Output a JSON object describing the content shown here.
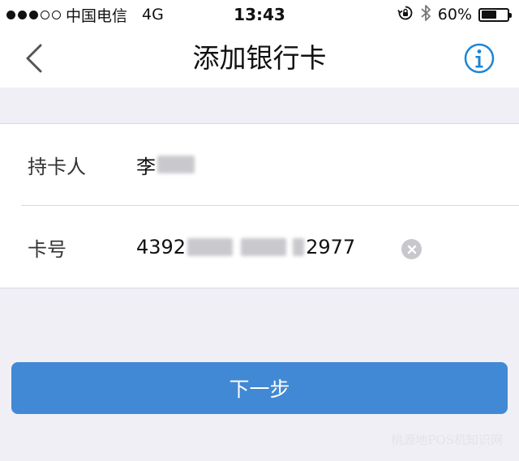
{
  "status_bar": {
    "carrier": "中国电信",
    "network": "4G",
    "time": "13:43",
    "battery_percent": "60%",
    "battery_level": 0.6
  },
  "nav": {
    "title": "添加银行卡",
    "back_icon": "chevron-left-icon",
    "info_icon": "info-icon",
    "accent_color": "#1a85d6"
  },
  "form": {
    "cardholder_label": "持卡人",
    "cardholder_value": "李",
    "card_number_label": "卡号",
    "card_number_prefix": "4392",
    "card_number_suffix": "2977",
    "clear_icon": "clear-icon"
  },
  "next_button": {
    "label": "下一步",
    "color": "#4189d4"
  },
  "watermark": "桃源地POS机知识网"
}
